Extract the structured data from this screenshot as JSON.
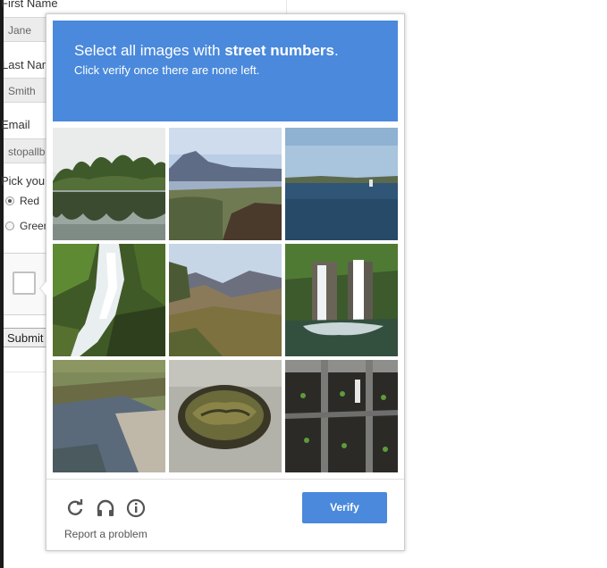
{
  "form": {
    "first_name_label": "First Name",
    "first_name_value": "Jane",
    "last_name_label": "Last Name",
    "last_name_value": "Smith",
    "email_label": "Email",
    "email_value": "stopallbots@gmail.com",
    "color_label": "Pick your favorite color:",
    "color_options": [
      "Red",
      "Green"
    ],
    "selected_color": "Red",
    "submit_label": "Submit"
  },
  "challenge": {
    "prompt_prefix": "Select all images with ",
    "prompt_target": "street numbers",
    "prompt_suffix": ".",
    "instruction": "Click verify once there are none left.",
    "verify_label": "Verify",
    "report_label": "Report a problem",
    "footer_icons": [
      "refresh-icon",
      "headphones-icon",
      "info-icon"
    ],
    "tiles": [
      "lake-with-trees-reflection",
      "volcano-lake-view",
      "open-lake-water",
      "waterfall-over-mossy-rocks",
      "mountain-valley",
      "twin-waterfall",
      "shallow-creek",
      "woven-basket-bowl",
      "seedling-trays"
    ]
  },
  "colors": {
    "accent": "#4a89dc",
    "banner_text": "#ffffff"
  }
}
